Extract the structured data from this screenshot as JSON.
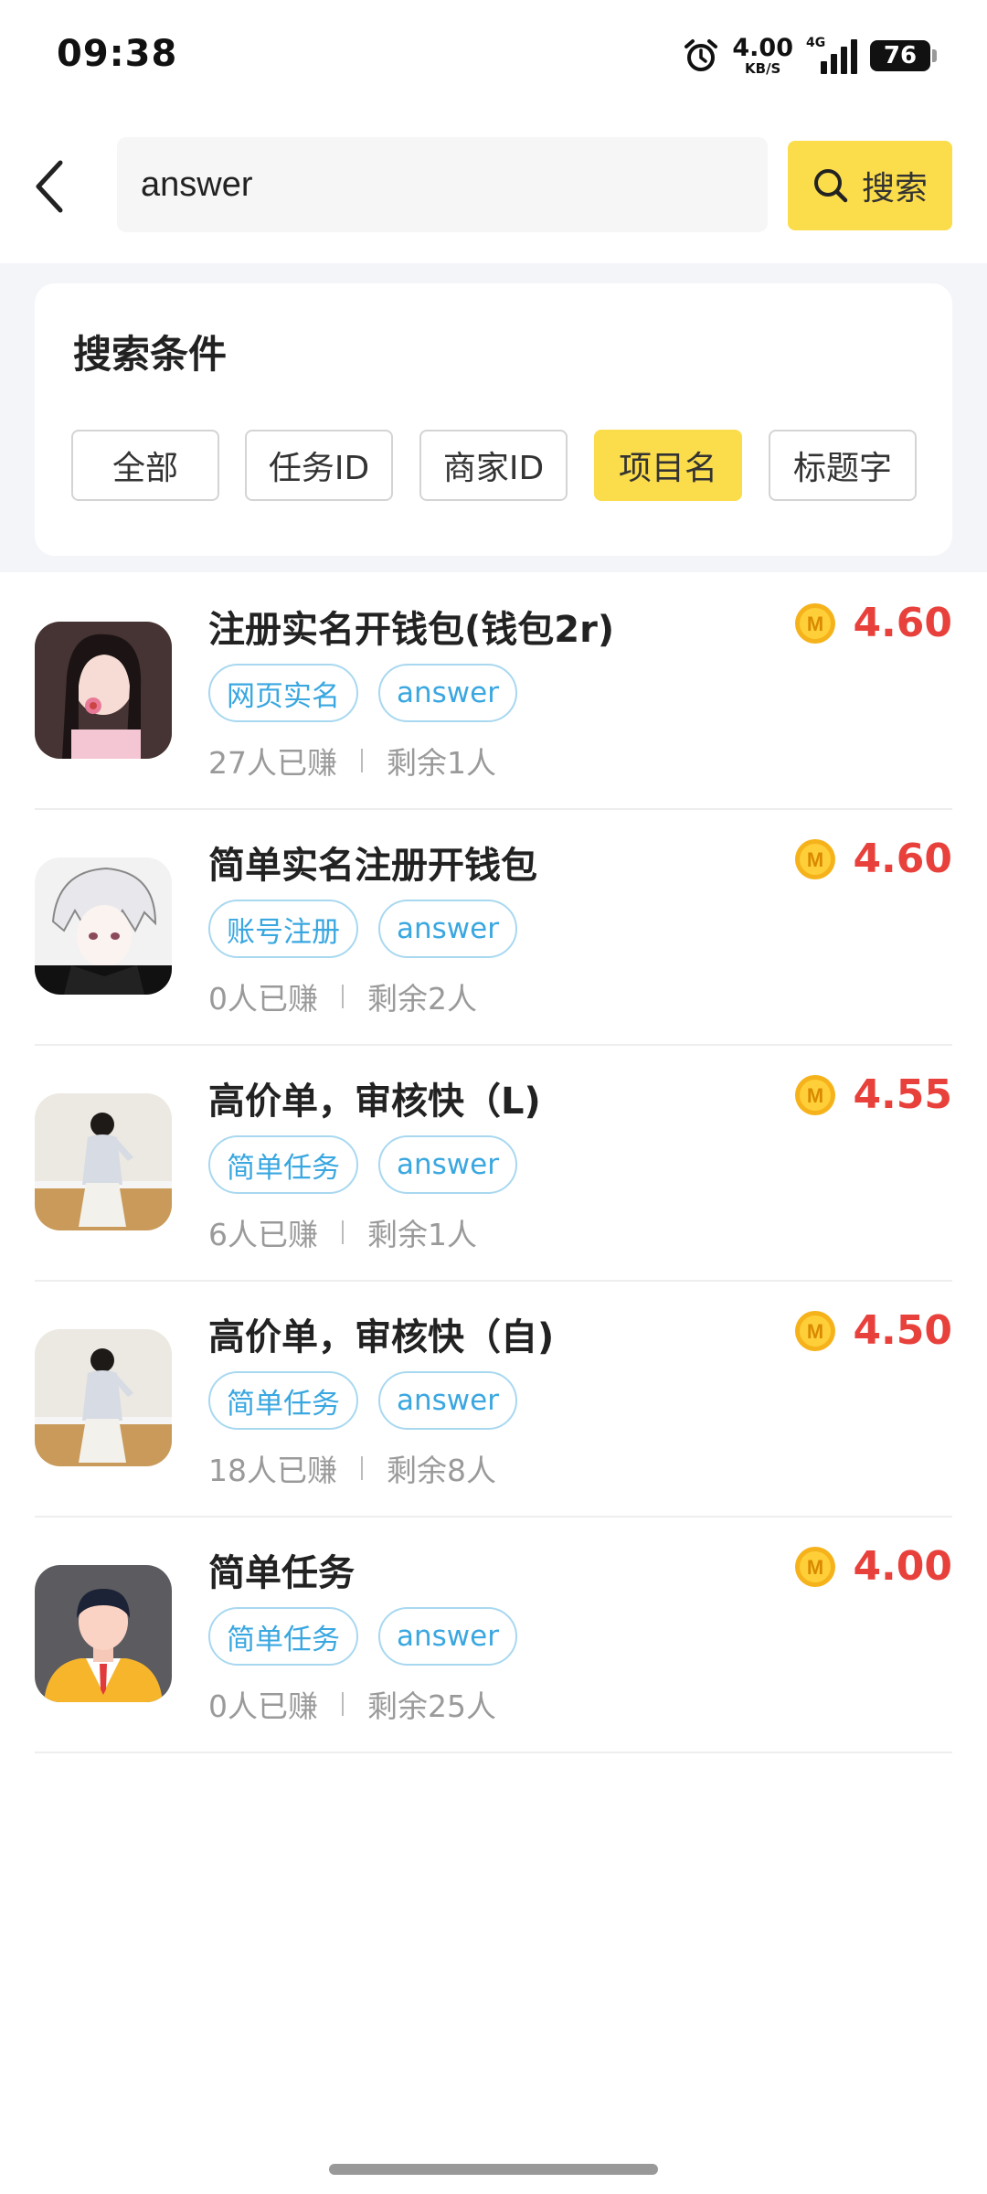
{
  "status_bar": {
    "time": "09:38",
    "net_speed_value": "4.00",
    "net_speed_unit": "KB/S",
    "network_type": "4G",
    "battery_level": "76",
    "icons": [
      "alarm-icon",
      "signal-icon",
      "battery-icon"
    ]
  },
  "search": {
    "query": "answer",
    "button_label": "搜索"
  },
  "filter": {
    "title": "搜索条件",
    "options": [
      "全部",
      "任务ID",
      "商家ID",
      "项目名",
      "标题字"
    ],
    "active_option": "项目名"
  },
  "colors": {
    "accent_yellow": "#fbdc4a",
    "price_red": "#e8413c",
    "tag_blue": "#3aa7e0"
  },
  "tasks": [
    {
      "title": "注册实名开钱包(钱包2r)",
      "tags": [
        "网页实名",
        "answer"
      ],
      "earned": "27人已赚",
      "remaining": "剩余1人",
      "reward": "4.60",
      "avatar": "girl-flower-avatar"
    },
    {
      "title": "简单实名注册开钱包",
      "tags": [
        "账号注册",
        "answer"
      ],
      "earned": "0人已赚",
      "remaining": "剩余2人",
      "reward": "4.60",
      "avatar": "anime-boy-avatar"
    },
    {
      "title": "高价单，审核快（L)",
      "tags": [
        "简单任务",
        "answer"
      ],
      "earned": "6人已赚",
      "remaining": "剩余1人",
      "reward": "4.55",
      "avatar": "girl-mirror-avatar"
    },
    {
      "title": "高价单，审核快（自)",
      "tags": [
        "简单任务",
        "answer"
      ],
      "earned": "18人已赚",
      "remaining": "剩余8人",
      "reward": "4.50",
      "avatar": "girl-mirror-avatar"
    },
    {
      "title": "简单任务",
      "tags": [
        "简单任务",
        "answer"
      ],
      "earned": "0人已赚",
      "remaining": "剩余25人",
      "reward": "4.00",
      "avatar": "businessman-avatar"
    }
  ]
}
